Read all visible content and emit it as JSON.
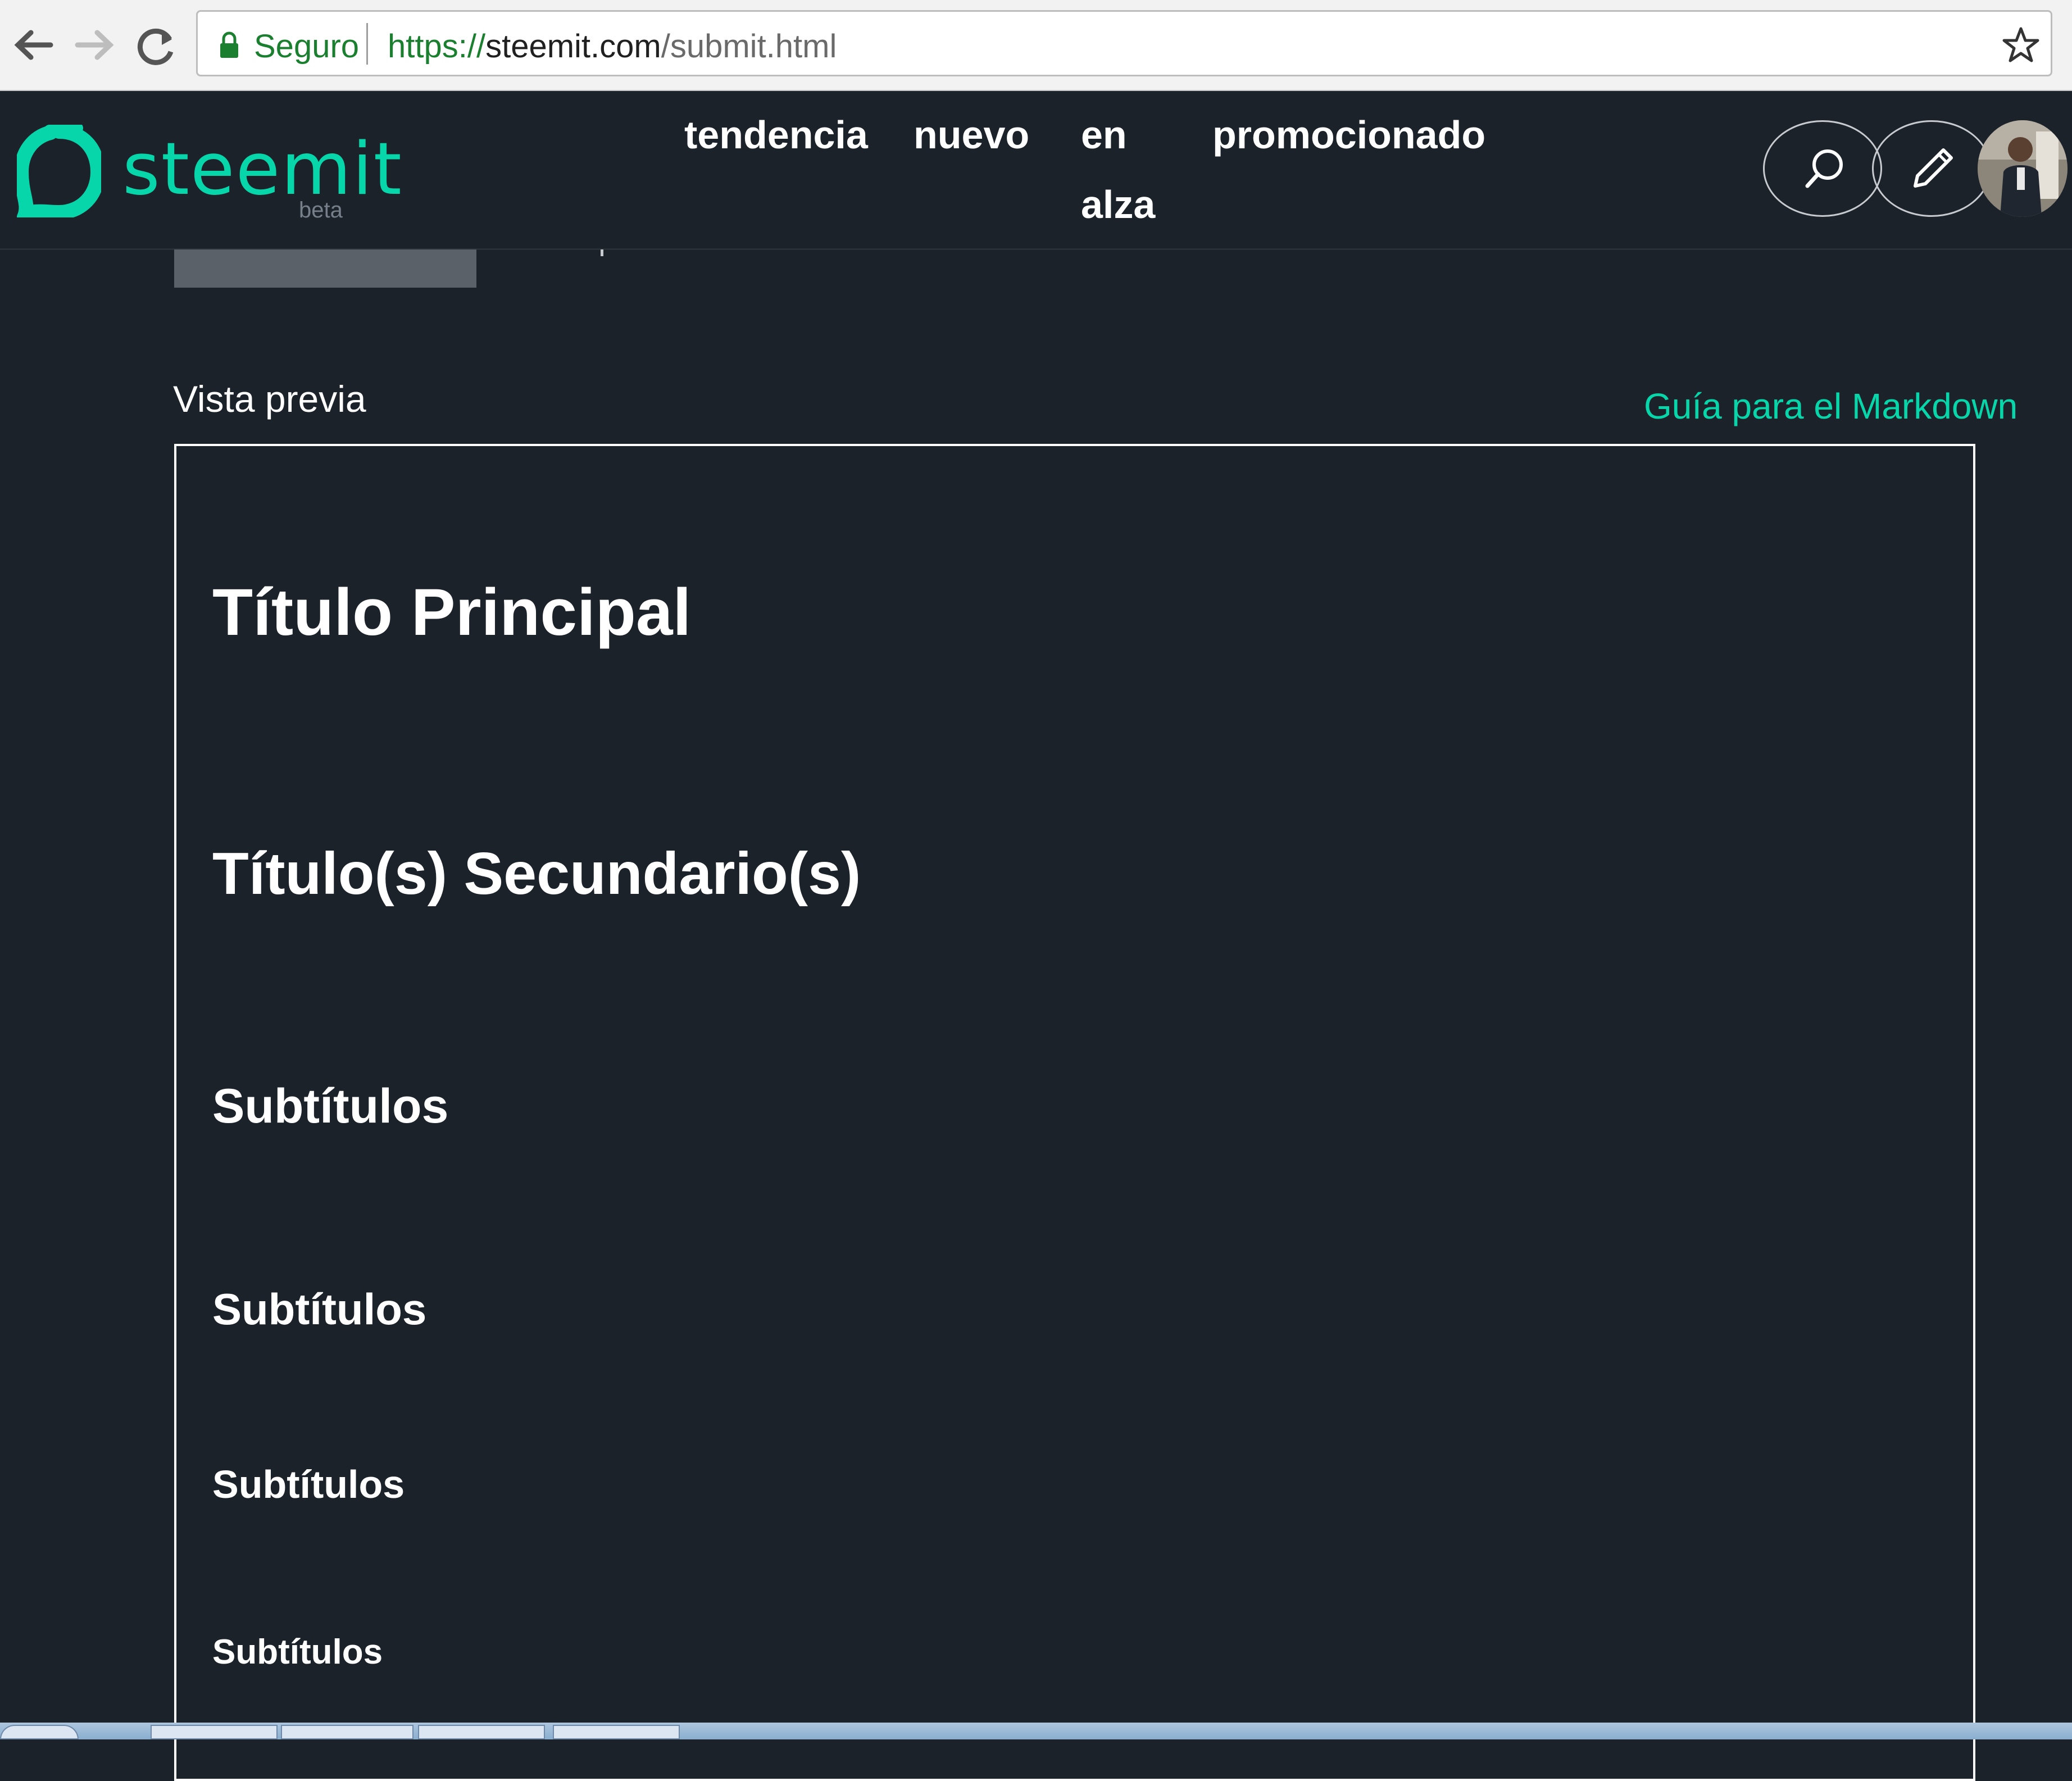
{
  "browser": {
    "security_label": "Seguro",
    "url_scheme": "https://",
    "url_host": "steemit.com",
    "url_path": "/submit.html"
  },
  "header": {
    "logo_text": "steemit",
    "logo_badge": "beta",
    "nav": {
      "trending": "tendencia",
      "new": "nuevo",
      "hot_line1": "en",
      "hot_line2": "alza",
      "promoted": "promocionado"
    },
    "accent_color": "#06d6a9"
  },
  "preview": {
    "label": "Vista previa",
    "markdown_guide_link": "Guía para el Markdown",
    "headings": {
      "h1": "Título Principal",
      "h2": "Título(s) Secundario(s)",
      "h3": "Subtítulos",
      "h4": "Subtítulos",
      "h5": "Subtítulos",
      "h6": "Subtítulos"
    }
  }
}
